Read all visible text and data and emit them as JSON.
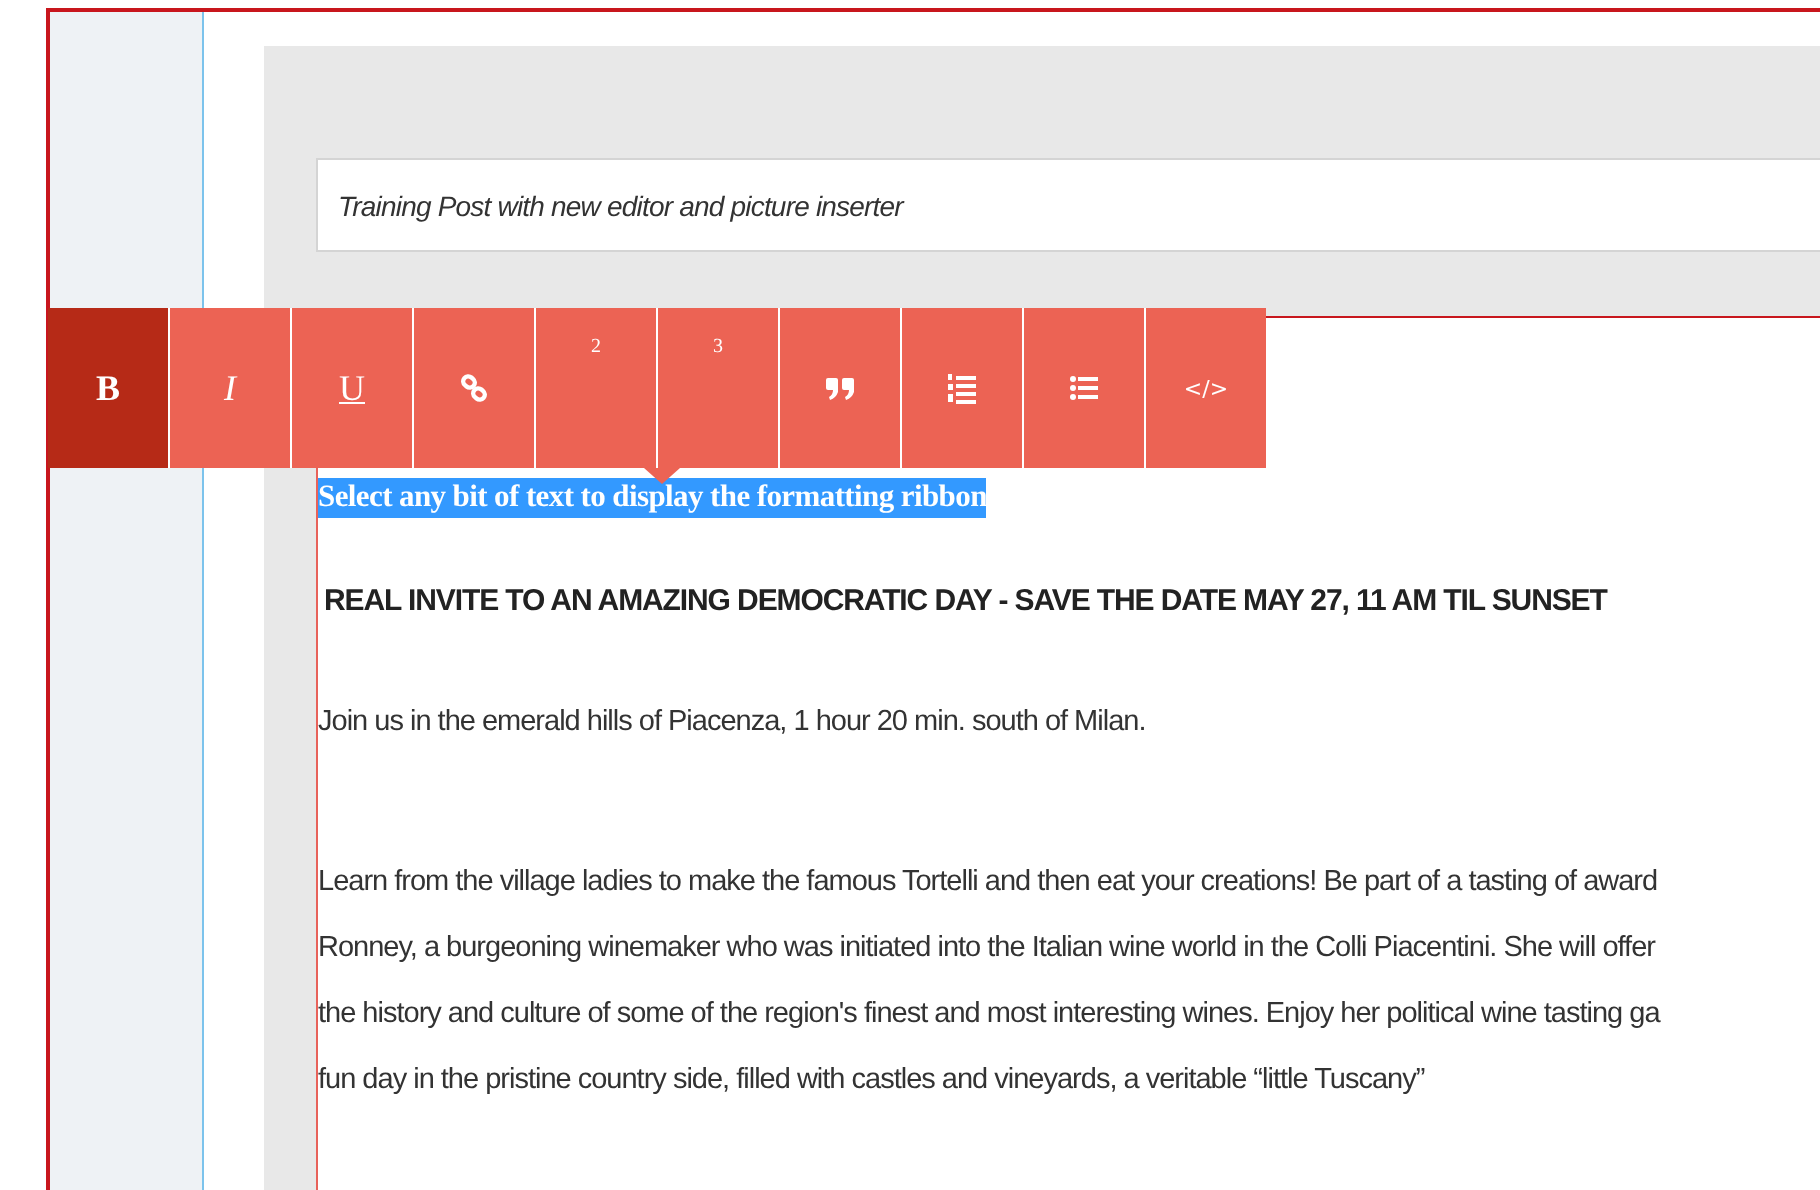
{
  "title_field": {
    "value": "Training Post with new editor and picture inserter"
  },
  "toolbar": {
    "buttons": [
      {
        "kind": "bold",
        "label": "B",
        "selected": true
      },
      {
        "kind": "italic",
        "label": "I",
        "selected": false
      },
      {
        "kind": "underline",
        "label": "U",
        "selected": false
      },
      {
        "kind": "link",
        "selected": false
      },
      {
        "kind": "superscript",
        "label": "2",
        "selected": false
      },
      {
        "kind": "superscript",
        "label": "3",
        "selected": false
      },
      {
        "kind": "quote",
        "selected": false
      },
      {
        "kind": "ordered-list",
        "selected": false
      },
      {
        "kind": "bullet-list",
        "selected": false
      },
      {
        "kind": "code",
        "label": "</>",
        "selected": false
      }
    ]
  },
  "content": {
    "hint": "Select any bit of text to display the formatting ribbon",
    "heading": "REAL INVITE TO AN AMAZING DEMOCRATIC DAY - SAVE THE DATE MAY 27, 11 AM TIL SUNSET",
    "intro": "Join us in the emerald hills of Piacenza, 1 hour 20 min. south of Milan.",
    "paragraph_lines": [
      "Learn from the village ladies to make the famous Tortelli and then eat your creations! Be part of a tasting of award",
      "Ronney, a burgeoning winemaker who was initiated into the Italian wine world in the Colli Piacentini. She will offer",
      "the history and culture of some of the region's finest and most interesting wines. Enjoy her political wine tasting ga",
      "fun day in the pristine country side, filled with castles and vineyards, a veritable “little Tuscany”"
    ]
  }
}
